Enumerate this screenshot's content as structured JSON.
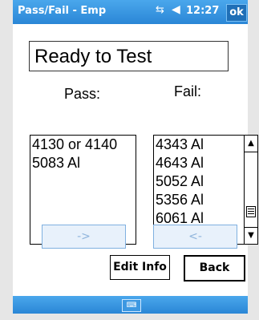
{
  "titlebar": {
    "title": "Pass/Fail - Emp",
    "time": "12:27",
    "ok_label": "ok"
  },
  "status": {
    "text": "Ready to Test"
  },
  "pass": {
    "label": "Pass:",
    "items": [
      "4130 or 4140",
      "5083 Al"
    ]
  },
  "fail": {
    "label": "Fail:",
    "items": [
      "4343 Al",
      "4643 Al",
      "5052 Al",
      "5356 Al",
      "6061 Al"
    ]
  },
  "buttons": {
    "move_to_pass": "->",
    "move_to_fail": "<-",
    "edit_info": "Edit Info",
    "back": "Back"
  },
  "icons": {
    "network": "network-icon",
    "volume": "speaker-icon",
    "keyboard": "keyboard-icon"
  },
  "colors": {
    "titlebar": "#2a86d6",
    "disabled_button_text": "#8fb4dc"
  }
}
